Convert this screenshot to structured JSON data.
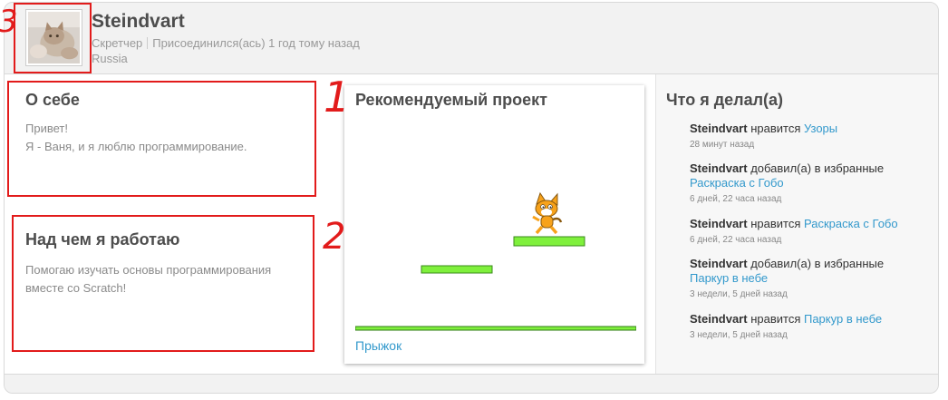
{
  "profile": {
    "username": "Steindvart",
    "role": "Скретчер",
    "joined": "Присоединился(ась) 1 год тому назад",
    "country": "Russia"
  },
  "about": {
    "title": "О себе",
    "line1": "Привет!",
    "line2": "Я - Ваня, и я люблю программирование."
  },
  "working_on": {
    "title": "Над чем я работаю",
    "text": "Помогаю изучать основы программирования вместе со Scratch!"
  },
  "featured": {
    "title": "Рекомендуемый проект",
    "project_name": "Прыжок"
  },
  "activity": {
    "title": "Что я делал(а)",
    "items": [
      {
        "user": "Steindvart",
        "action": "нравится",
        "target": "Узоры",
        "time": "28 минут назад"
      },
      {
        "user": "Steindvart",
        "action": "добавил(а) в избранные",
        "target": "Раскраска с Гобо",
        "time": "6 дней, 22 часа назад"
      },
      {
        "user": "Steindvart",
        "action": "нравится",
        "target": "Раскраска с Гобо",
        "time": "6 дней, 22 часа назад"
      },
      {
        "user": "Steindvart",
        "action": "добавил(а) в избранные",
        "target": "Паркур в небе",
        "time": "3 недели, 5 дней назад"
      },
      {
        "user": "Steindvart",
        "action": "нравится",
        "target": "Паркур в небе",
        "time": "3 недели, 5 дней назад"
      }
    ]
  },
  "annotations": {
    "mark1": "1",
    "mark2": "2",
    "mark3": "3",
    "color": "#e21b1b"
  },
  "colors": {
    "link": "#3399cc",
    "platform_green": "#7ff03c",
    "cat_orange": "#f7a21b"
  },
  "icons": {
    "avatar": "cat-photo-avatar",
    "sprite": "scratch-cat-icon"
  }
}
